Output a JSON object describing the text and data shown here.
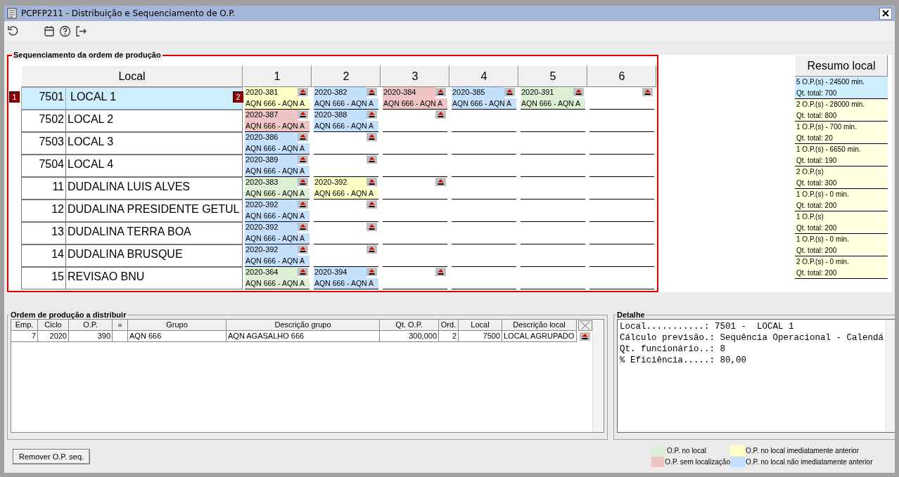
{
  "window": {
    "title": "PCPFP211 - Distribuição e Sequenciamento de O.P."
  },
  "sequencing": {
    "title": "Sequenciamento da ordem de produção",
    "local_header": "Local",
    "columns": [
      "1",
      "2",
      "3",
      "4",
      "5",
      "6"
    ],
    "summary_header": "Resumo local",
    "badges": [
      "1",
      "2"
    ],
    "rows": [
      {
        "code": "7501",
        "name": "LOCAL 1",
        "selected": true,
        "summary": [
          "5 O.P.(s) - 24500 min.",
          "Qt. total: 700"
        ],
        "cells": [
          {
            "kind": "op",
            "op": "2020-381",
            "desc": "AQN 666 - AQN A",
            "color": "#ffffc8"
          },
          {
            "kind": "op",
            "op": "2020-382",
            "desc": "AQN 666 - AQN A",
            "color": "#c4e0fc"
          },
          {
            "kind": "op",
            "op": "2020-384",
            "desc": "AQN 666 - AQN A",
            "color": "#f0c4c4"
          },
          {
            "kind": "op",
            "op": "2020-385",
            "desc": "AQN 666 - AQN A",
            "color": "#c4e0fc"
          },
          {
            "kind": "op",
            "op": "2020-391",
            "desc": "AQN 666 - AQN A",
            "color": "#ddefd4"
          },
          {
            "kind": "drop"
          }
        ]
      },
      {
        "code": "7502",
        "name": "LOCAL 2",
        "selected": false,
        "summary": [
          "2 O.P.(s) - 28000 min.",
          "Qt. total: 800"
        ],
        "cells": [
          {
            "kind": "op",
            "op": "2020-387",
            "desc": "AQN 666 - AQN A",
            "color": "#f0c4c4"
          },
          {
            "kind": "op",
            "op": "2020-388",
            "desc": "AQN 666 - AQN A",
            "color": "#c4e0fc"
          },
          {
            "kind": "drop"
          },
          {
            "kind": "empty"
          },
          {
            "kind": "empty"
          },
          {
            "kind": "empty"
          }
        ]
      },
      {
        "code": "7503",
        "name": "LOCAL 3",
        "selected": false,
        "summary": [
          "1 O.P.(s) - 700 min.",
          "Qt. total: 20"
        ],
        "cells": [
          {
            "kind": "op",
            "op": "2020-386",
            "desc": "AQN 666 - AQN A",
            "color": "#c4e0fc"
          },
          {
            "kind": "drop"
          },
          {
            "kind": "empty"
          },
          {
            "kind": "empty"
          },
          {
            "kind": "empty"
          },
          {
            "kind": "empty"
          }
        ]
      },
      {
        "code": "7504",
        "name": "LOCAL 4",
        "selected": false,
        "summary": [
          "1 O.P.(s) - 6650 min.",
          "Qt. total: 190"
        ],
        "cells": [
          {
            "kind": "op",
            "op": "2020-389",
            "desc": "AQN 666 - AQN A",
            "color": "#c4e0fc"
          },
          {
            "kind": "drop"
          },
          {
            "kind": "empty"
          },
          {
            "kind": "empty"
          },
          {
            "kind": "empty"
          },
          {
            "kind": "empty"
          }
        ]
      },
      {
        "code": "11",
        "name": "DUDALINA LUIS ALVES",
        "selected": false,
        "summary": [
          "2 O.P.(s)",
          "Qt. total: 300"
        ],
        "cells": [
          {
            "kind": "op",
            "op": "2020-383",
            "desc": "AQN 666 - AQN A",
            "color": "#ddefd4"
          },
          {
            "kind": "op",
            "op": "2020-392",
            "desc": "AQN 666 - AQN A",
            "color": "#ffffc8"
          },
          {
            "kind": "drop"
          },
          {
            "kind": "empty"
          },
          {
            "kind": "empty"
          },
          {
            "kind": "empty"
          }
        ]
      },
      {
        "code": "12",
        "name": "DUDALINA PRESIDENTE GETUL",
        "selected": false,
        "summary": [
          "1 O.P.(s) - 0 min.",
          "Qt. total: 200"
        ],
        "cells": [
          {
            "kind": "op",
            "op": "2020-392",
            "desc": "AQN 666 - AQN A",
            "color": "#c4e0fc"
          },
          {
            "kind": "drop"
          },
          {
            "kind": "empty"
          },
          {
            "kind": "empty"
          },
          {
            "kind": "empty"
          },
          {
            "kind": "empty"
          }
        ]
      },
      {
        "code": "13",
        "name": "DUDALINA TERRA BOA",
        "selected": false,
        "summary": [
          "1 O.P.(s)",
          "Qt. total: 200"
        ],
        "cells": [
          {
            "kind": "op",
            "op": "2020-392",
            "desc": "AQN 666 - AQN A",
            "color": "#c4e0fc"
          },
          {
            "kind": "drop"
          },
          {
            "kind": "empty"
          },
          {
            "kind": "empty"
          },
          {
            "kind": "empty"
          },
          {
            "kind": "empty"
          }
        ]
      },
      {
        "code": "14",
        "name": "DUDALINA BRUSQUE",
        "selected": false,
        "summary": [
          "1 O.P.(s) - 0 min.",
          "Qt. total: 200"
        ],
        "cells": [
          {
            "kind": "op",
            "op": "2020-392",
            "desc": "AQN 666 - AQN A",
            "color": "#c4e0fc"
          },
          {
            "kind": "drop"
          },
          {
            "kind": "empty"
          },
          {
            "kind": "empty"
          },
          {
            "kind": "empty"
          },
          {
            "kind": "empty"
          }
        ]
      },
      {
        "code": "15",
        "name": "REVISAO BNU",
        "selected": false,
        "summary": [
          "2 O.P.(s) - 0 min.",
          "Qt. total: 200"
        ],
        "cells": [
          {
            "kind": "op",
            "op": "2020-364",
            "desc": "AQN 666 - AQN A",
            "color": "#ddefd4"
          },
          {
            "kind": "op",
            "op": "2020-394",
            "desc": "AQN 666 - AQN A",
            "color": "#c4e0fc"
          },
          {
            "kind": "drop"
          },
          {
            "kind": "empty"
          },
          {
            "kind": "empty"
          },
          {
            "kind": "empty"
          }
        ]
      }
    ]
  },
  "orders": {
    "title": "Ordem de produção a distribuir",
    "columns": [
      "Emp.",
      "Ciclo",
      "O.P.",
      "»",
      "Grupo",
      "Descrição grupo",
      "Qt. O.P.",
      "Ord.",
      "Local",
      "Descrição local"
    ],
    "rows": [
      {
        "cells": [
          "7",
          "2020",
          "390",
          "",
          "AQN 666",
          "AQN AGASALHO 666",
          "300,000",
          "2",
          "7500",
          "LOCAL AGRUPADO"
        ]
      }
    ]
  },
  "detail": {
    "title": "Detalhe",
    "lines": [
      "Local...........: 7501 -  LOCAL 1",
      "Cálculo previsão.: Sequência Operacional - Calendá",
      "Qt. funcionário..: 8",
      "% Eficiência.....: 80,00"
    ]
  },
  "remove_button": "Remover O.P. seq.",
  "legend": [
    {
      "label": "O.P. no local",
      "color": "#ddefd4"
    },
    {
      "label": "O.P. no local imediatamente anterior",
      "color": "#ffffc8"
    },
    {
      "label": "O.P. sem localização",
      "color": "#f0c4c4"
    },
    {
      "label": "O.P. no local não imediatamente anterior",
      "color": "#c4e0fc"
    }
  ]
}
